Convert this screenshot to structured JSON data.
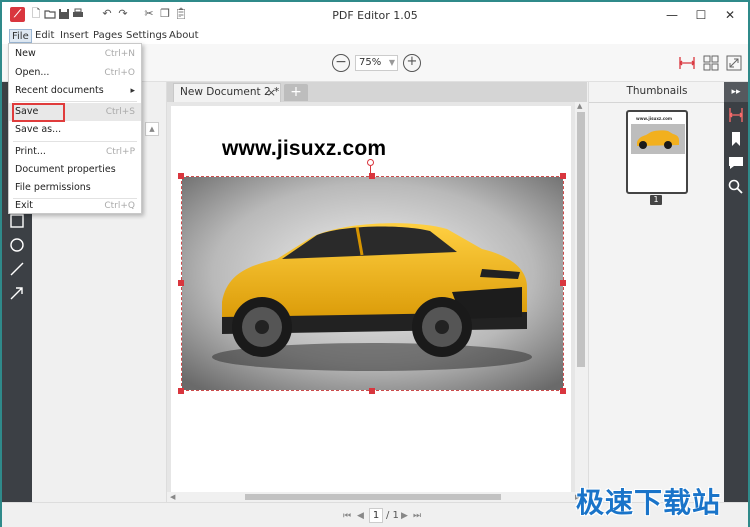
{
  "window": {
    "title": "PDF Editor 1.05"
  },
  "quick_toolbar": {
    "icons": [
      "app-logo",
      "new-file-icon",
      "open-folder-icon",
      "save-icon",
      "print-icon",
      "undo-icon",
      "redo-icon",
      "cut-icon",
      "copy-icon",
      "paste-icon"
    ]
  },
  "window_controls": {
    "minimize": "—",
    "maximize": "☐",
    "close": "✕"
  },
  "menubar": {
    "items": [
      "File",
      "Edit",
      "Insert",
      "Pages",
      "Settings",
      "About"
    ]
  },
  "toolbar": {
    "zoom_value": "75%",
    "zoom_out": "−",
    "zoom_in": "+"
  },
  "file_menu": {
    "new": {
      "label": "New",
      "shortcut": "Ctrl+N"
    },
    "open": {
      "label": "Open...",
      "shortcut": "Ctrl+O"
    },
    "recent": {
      "label": "Recent documents",
      "arrow": "▸"
    },
    "save": {
      "label": "Save",
      "shortcut": "Ctrl+S"
    },
    "save_as": {
      "label": "Save as..."
    },
    "print": {
      "label": "Print...",
      "shortcut": "Ctrl+P"
    },
    "doc_props": {
      "label": "Document properties"
    },
    "file_perms": {
      "label": "File permissions"
    },
    "exit": {
      "label": "Exit",
      "shortcut": "Ctrl+Q"
    }
  },
  "tabs": {
    "doc_tab": "New Document 2 *",
    "close": "×",
    "add": "+"
  },
  "document": {
    "heading": "www.jisuxz.com"
  },
  "thumbnails": {
    "title": "Thumbnails",
    "page_number": "1",
    "thumb_caption": "www.jisuxz.com"
  },
  "statusbar": {
    "current_page": "1",
    "total": "/ 1"
  },
  "watermark": "极速下载站",
  "colors": {
    "accent": "#d9363e",
    "frame": "#2f8a8a",
    "dark_strip": "#3c4045",
    "car": "#f2b01e",
    "watermark": "#1a74c9"
  }
}
